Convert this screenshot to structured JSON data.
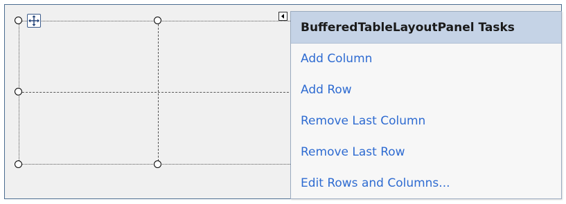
{
  "tasks_panel": {
    "title": "BufferedTableLayoutPanel Tasks",
    "actions": [
      {
        "label": "Add Column"
      },
      {
        "label": "Add Row"
      },
      {
        "label": "Remove Last Column"
      },
      {
        "label": "Remove Last Row"
      },
      {
        "label": "Edit Rows and Columns..."
      }
    ]
  },
  "icons": {
    "move_glyph": "move-arrows-icon",
    "smart_tag": "smart-tag-arrow-icon"
  },
  "colors": {
    "link": "#2e6bd1",
    "header_bg": "#c5d3e6",
    "surface_bg": "#f0f0f0",
    "surface_border": "#4a6b8f"
  }
}
